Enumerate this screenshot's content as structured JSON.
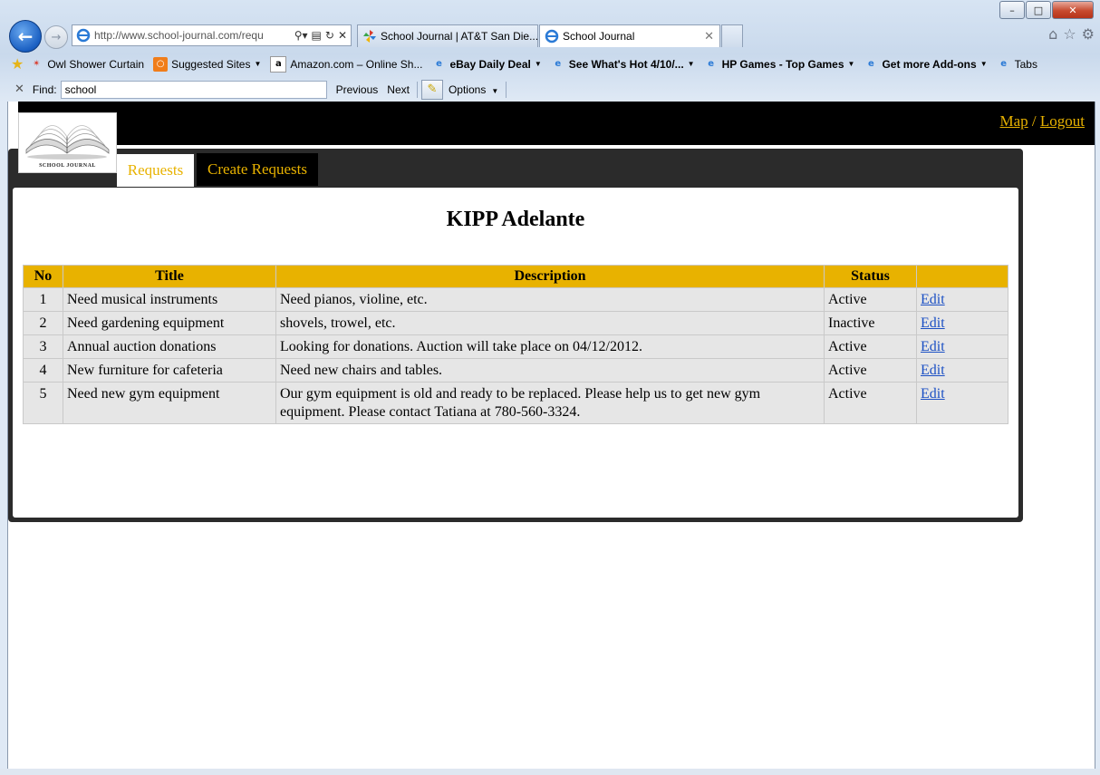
{
  "browser": {
    "address_url": "http://www.school-journal.com/requ",
    "tabs": [
      {
        "title": "School Journal | AT&T San Die..."
      },
      {
        "title": "School Journal"
      }
    ],
    "favorites": [
      {
        "label": "Owl Shower Curtain"
      },
      {
        "label": "Suggested Sites"
      },
      {
        "label": "Amazon.com – Online Sh..."
      },
      {
        "label": "eBay Daily Deal"
      },
      {
        "label": "See What's Hot 4/10/..."
      },
      {
        "label": "HP Games - Top Games"
      },
      {
        "label": "Get more Add-ons"
      },
      {
        "label": "Tabs"
      }
    ],
    "find": {
      "label": "Find:",
      "value": "school",
      "previous": "Previous",
      "next": "Next",
      "options": "Options"
    }
  },
  "site": {
    "logo_caption": "SCHOOL JOURNAL",
    "links": {
      "map": "Map",
      "sep": "/",
      "logout": "Logout"
    },
    "tabs": [
      {
        "label": "Requests",
        "active": true
      },
      {
        "label": "Create Requests",
        "active": false
      }
    ],
    "school_name": "KIPP Adelante",
    "table": {
      "headers": [
        "No",
        "Title",
        "Description",
        "Status",
        ""
      ],
      "rows": [
        {
          "no": "1",
          "title": "Need musical instruments",
          "description": "Need pianos, violine, etc.",
          "status": "Active",
          "action": "Edit"
        },
        {
          "no": "2",
          "title": "Need gardening equipment",
          "description": "shovels, trowel, etc.",
          "status": "Inactive",
          "action": "Edit"
        },
        {
          "no": "3",
          "title": "Annual auction donations",
          "description": "Looking for donations. Auction will take place on 04/12/2012.",
          "status": "Active",
          "action": "Edit"
        },
        {
          "no": "4",
          "title": "New furniture for cafeteria",
          "description": "Need new chairs and tables.",
          "status": "Active",
          "action": "Edit"
        },
        {
          "no": "5",
          "title": "Need new gym equipment",
          "description": "Our gym equipment is old and ready to be replaced. Please help us to get new gym equipment. Please contact Tatiana at 780-560-3324.",
          "status": "Active",
          "action": "Edit"
        }
      ]
    }
  }
}
